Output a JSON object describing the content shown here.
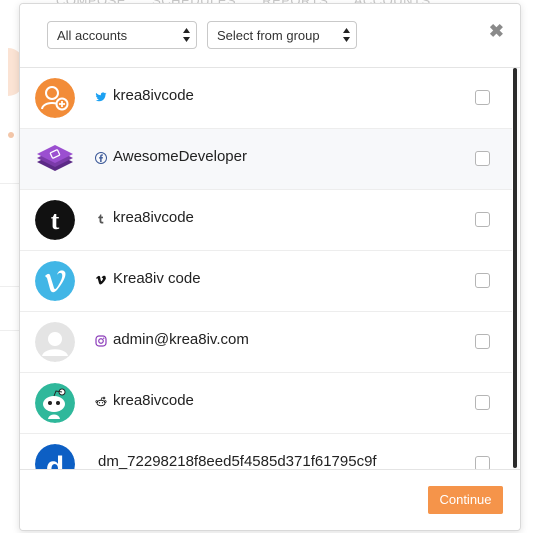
{
  "background": {
    "tabs": [
      "COMPOSE",
      "SCHEDULES",
      "REPORTS",
      "ACCOUNTS"
    ]
  },
  "filters": {
    "accounts_select": {
      "value": "All accounts"
    },
    "group_select": {
      "value": "Select from group"
    }
  },
  "close_label": "✖",
  "accounts": [
    {
      "network": "twitter",
      "icon": "twitter-icon",
      "name": "krea8ivcode",
      "checked": false,
      "avatar": "user-add-avatar"
    },
    {
      "network": "facebook",
      "icon": "facebook-icon",
      "name": "AwesomeDeveloper",
      "checked": false,
      "avatar": "stack-avatar"
    },
    {
      "network": "tumblr",
      "icon": "tumblr-icon",
      "name": "krea8ivcode",
      "checked": false,
      "avatar": "tumblr-avatar"
    },
    {
      "network": "vimeo",
      "icon": "vimeo-icon",
      "name": "Krea8iv code",
      "checked": false,
      "avatar": "vimeo-avatar"
    },
    {
      "network": "instagram",
      "icon": "instagram-icon",
      "name": "admin@krea8iv.com",
      "checked": false,
      "avatar": "default-user-avatar"
    },
    {
      "network": "reddit",
      "icon": "reddit-icon",
      "name": "krea8ivcode",
      "checked": false,
      "avatar": "reddit-avatar"
    },
    {
      "network": "dailymotion",
      "icon": "",
      "name": "dm_72298218f8eed5f4585d371f61795c9f",
      "checked": false,
      "avatar": "dailymotion-avatar"
    }
  ],
  "footer": {
    "continue_label": "Continue"
  },
  "colors": {
    "accent": "#f5944a",
    "twitter": "#1da1f2",
    "facebook": "#3b5998",
    "instagram": "#8a3ab9",
    "vimeo": "#41b6e6"
  }
}
